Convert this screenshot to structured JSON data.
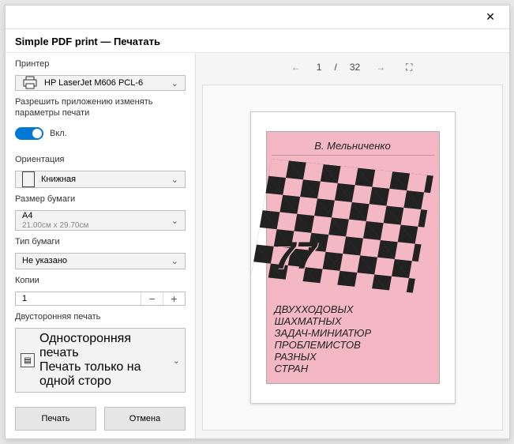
{
  "window": {
    "title": "Simple PDF print — Печатать"
  },
  "printer": {
    "label": "Принтер",
    "value": "HP LaserJet M606 PCL-6"
  },
  "allow": {
    "text": "Разрешить приложению изменять параметры печати",
    "toggle_label": "Вкл."
  },
  "orientation": {
    "label": "Ориентация",
    "value": "Книжная"
  },
  "paper_size": {
    "label": "Размер бумаги",
    "value": "A4",
    "sub": "21.00см x 29.70см"
  },
  "paper_type": {
    "label": "Тип бумаги",
    "value": "Не указано"
  },
  "copies": {
    "label": "Копии",
    "value": "1"
  },
  "duplex": {
    "label": "Двусторонняя печать",
    "value": "Односторонняя печать",
    "sub": "Печать только на одной сторо"
  },
  "buttons": {
    "print": "Печать",
    "cancel": "Отмена"
  },
  "nav": {
    "page": "1",
    "sep": "/",
    "total": "32"
  },
  "cover": {
    "author": "В. Мельниченко",
    "lines": [
      "ДВУХХОДОВЫХ",
      "ШАХМАТНЫХ",
      "ЗАДАЧ-МИНИАТЮР",
      "ПРОБЛЕМИСТОВ",
      "РАЗНЫХ",
      "СТРАН"
    ]
  }
}
